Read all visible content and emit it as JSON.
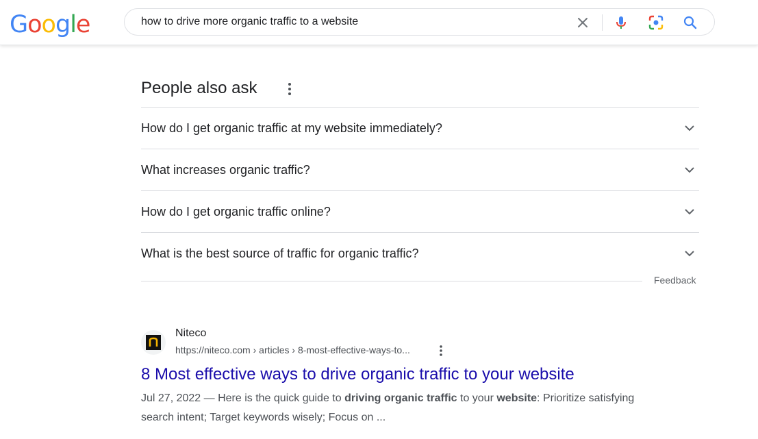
{
  "header": {
    "logo_text": "Google",
    "search_value": "how to drive more organic traffic to a website",
    "icons": [
      "clear-icon",
      "microphone-icon",
      "lens-icon",
      "search-icon"
    ]
  },
  "paa": {
    "title": "People also ask",
    "questions": [
      "How do I get organic traffic at my website immediately?",
      "What increases organic traffic?",
      "How do I get organic traffic online?",
      "What is the best source of traffic for organic traffic?"
    ],
    "feedback_label": "Feedback"
  },
  "result": {
    "site_name": "Niteco",
    "favicon_letter": "n",
    "url": "https://niteco.com › articles › 8-most-effective-ways-to...",
    "title": "8 Most effective ways to drive organic traffic to your website",
    "date": "Jul 27, 2022",
    "snippet_parts": [
      " — Here is the quick guide to ",
      "driving organic traffic",
      " to your ",
      "website",
      ": Prioritize satisfying search intent; Target keywords wisely; Focus on ..."
    ]
  },
  "colors": {
    "link": "#1a0dab",
    "google_blue": "#4285F4",
    "google_red": "#EA4335",
    "google_yellow": "#FBBC05",
    "google_green": "#34A853"
  }
}
